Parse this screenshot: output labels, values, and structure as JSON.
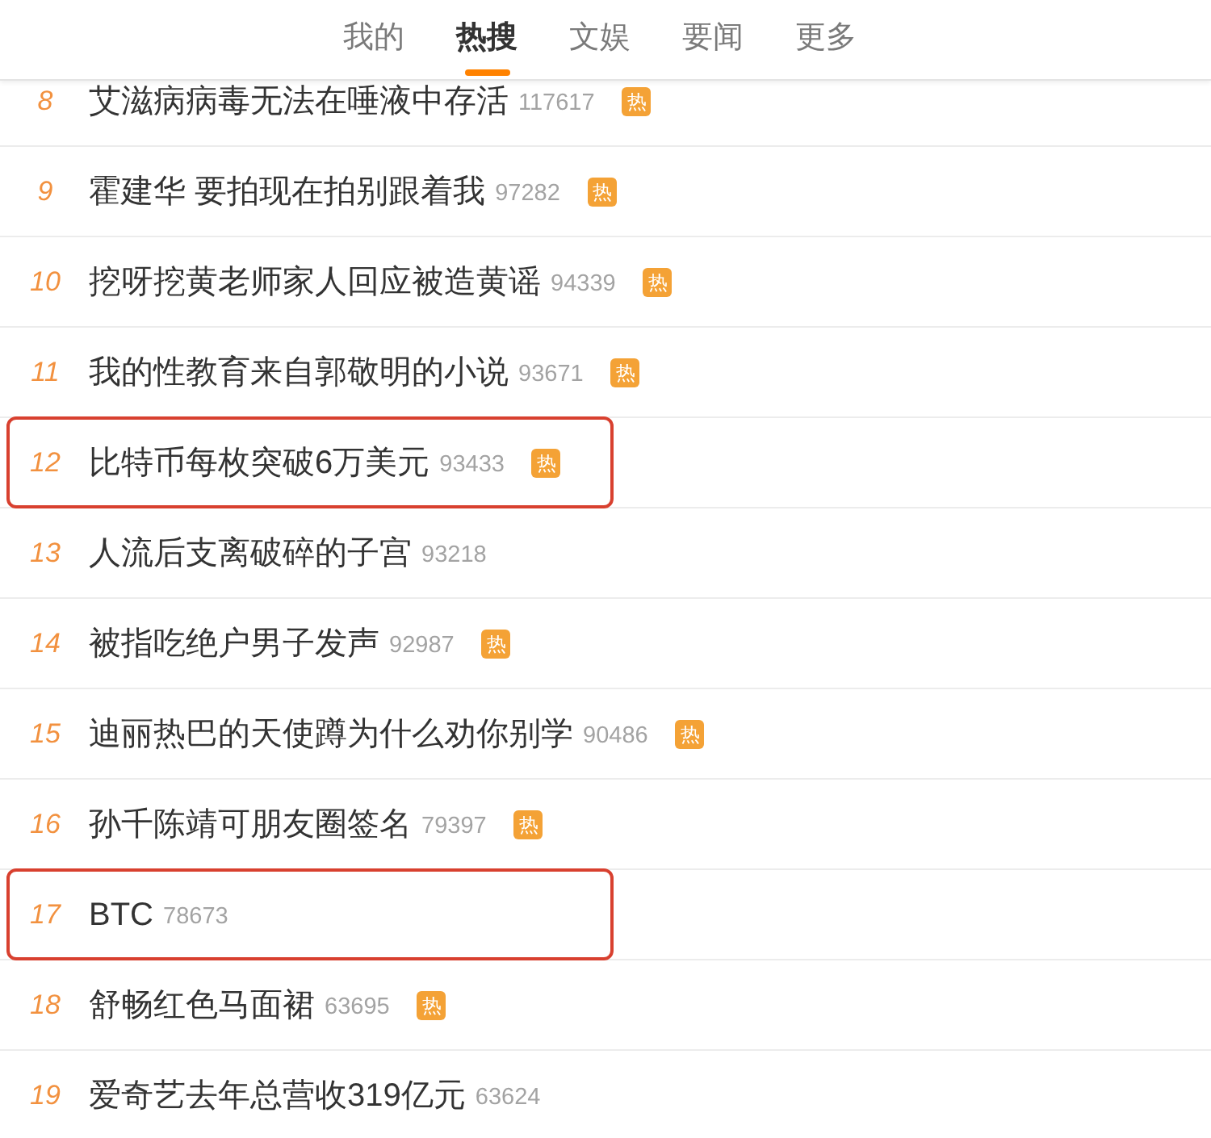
{
  "tabs": [
    {
      "label": "我的",
      "selected": false
    },
    {
      "label": "热搜",
      "selected": true
    },
    {
      "label": "文娱",
      "selected": false
    },
    {
      "label": "要闻",
      "selected": false
    },
    {
      "label": "更多",
      "selected": false
    }
  ],
  "rows": [
    {
      "rank": "8",
      "title": "艾滋病病毒无法在唾液中存活",
      "count": "117617",
      "badge": "热",
      "highlighted": false
    },
    {
      "rank": "9",
      "title": "霍建华 要拍现在拍别跟着我",
      "count": "97282",
      "badge": "热",
      "highlighted": false
    },
    {
      "rank": "10",
      "title": "挖呀挖黄老师家人回应被造黄谣",
      "count": "94339",
      "badge": "热",
      "highlighted": false
    },
    {
      "rank": "11",
      "title": "我的性教育来自郭敬明的小说",
      "count": "93671",
      "badge": "热",
      "highlighted": false
    },
    {
      "rank": "12",
      "title": "比特币每枚突破6万美元",
      "count": "93433",
      "badge": "热",
      "highlighted": true
    },
    {
      "rank": "13",
      "title": "人流后支离破碎的子宫",
      "count": "93218",
      "highlighted": false
    },
    {
      "rank": "14",
      "title": "被指吃绝户男子发声",
      "count": "92987",
      "badge": "热",
      "highlighted": false
    },
    {
      "rank": "15",
      "title": "迪丽热巴的天使蹲为什么劝你别学",
      "count": "90486",
      "badge": "热",
      "highlighted": false
    },
    {
      "rank": "16",
      "title": "孙千陈靖可朋友圈签名",
      "count": "79397",
      "badge": "热",
      "highlighted": false
    },
    {
      "rank": "17",
      "title": "BTC",
      "count": "78673",
      "highlighted": true
    },
    {
      "rank": "18",
      "title": "舒畅红色马面裙",
      "count": "63695",
      "badge": "热",
      "highlighted": false
    },
    {
      "rank": "19",
      "title": "爱奇艺去年总营收319亿元",
      "count": "63624",
      "highlighted": false
    }
  ]
}
